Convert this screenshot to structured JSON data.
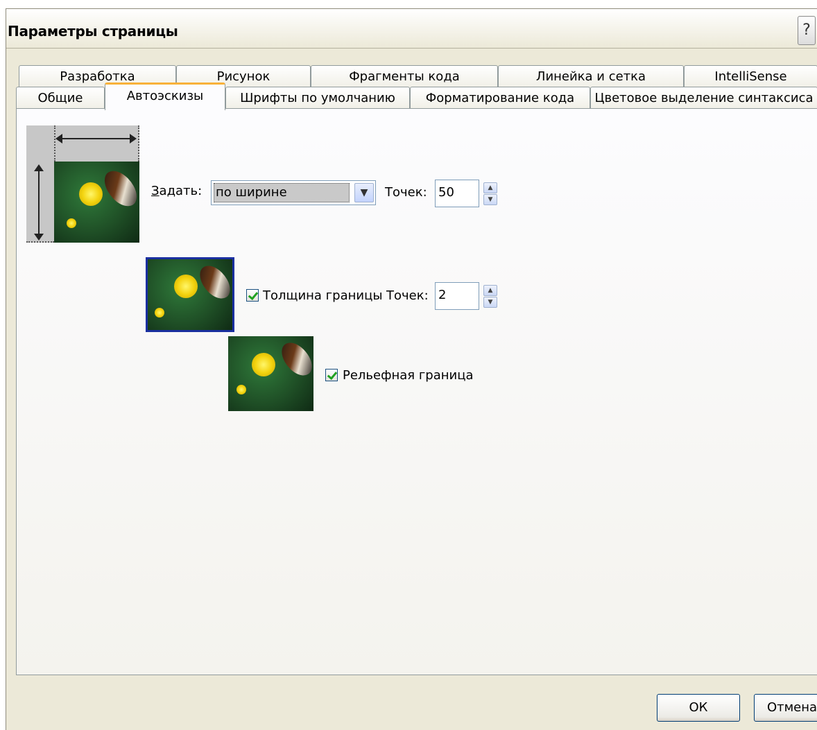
{
  "dialog": {
    "title": "Параметры страницы",
    "help_label": "?"
  },
  "tabs": {
    "row1": [
      "Разработка",
      "Рисунок",
      "Фрагменты кода",
      "Линейка и сетка",
      "IntelliSense"
    ],
    "row2": [
      "Общие",
      "Автоэскизы",
      "Шрифты по умолчанию",
      "Форматирование кода",
      "Цветовое выделение синтаксиса"
    ],
    "active": "Автоэскизы"
  },
  "size": {
    "set_label": "Задать:",
    "set_value": "по ширине",
    "points_label": "Точек:",
    "points_value": "50"
  },
  "border": {
    "checked": true,
    "label": "Толщина границы",
    "points_label": "Точек:",
    "points_value": "2"
  },
  "relief": {
    "checked": true,
    "label": "Рельефная граница"
  },
  "buttons": {
    "ok": "ОК",
    "cancel": "Отмена"
  },
  "icons": {
    "dropdown": "chevron-down-icon",
    "spin_up": "arrow-up-icon",
    "spin_down": "arrow-down-icon"
  }
}
